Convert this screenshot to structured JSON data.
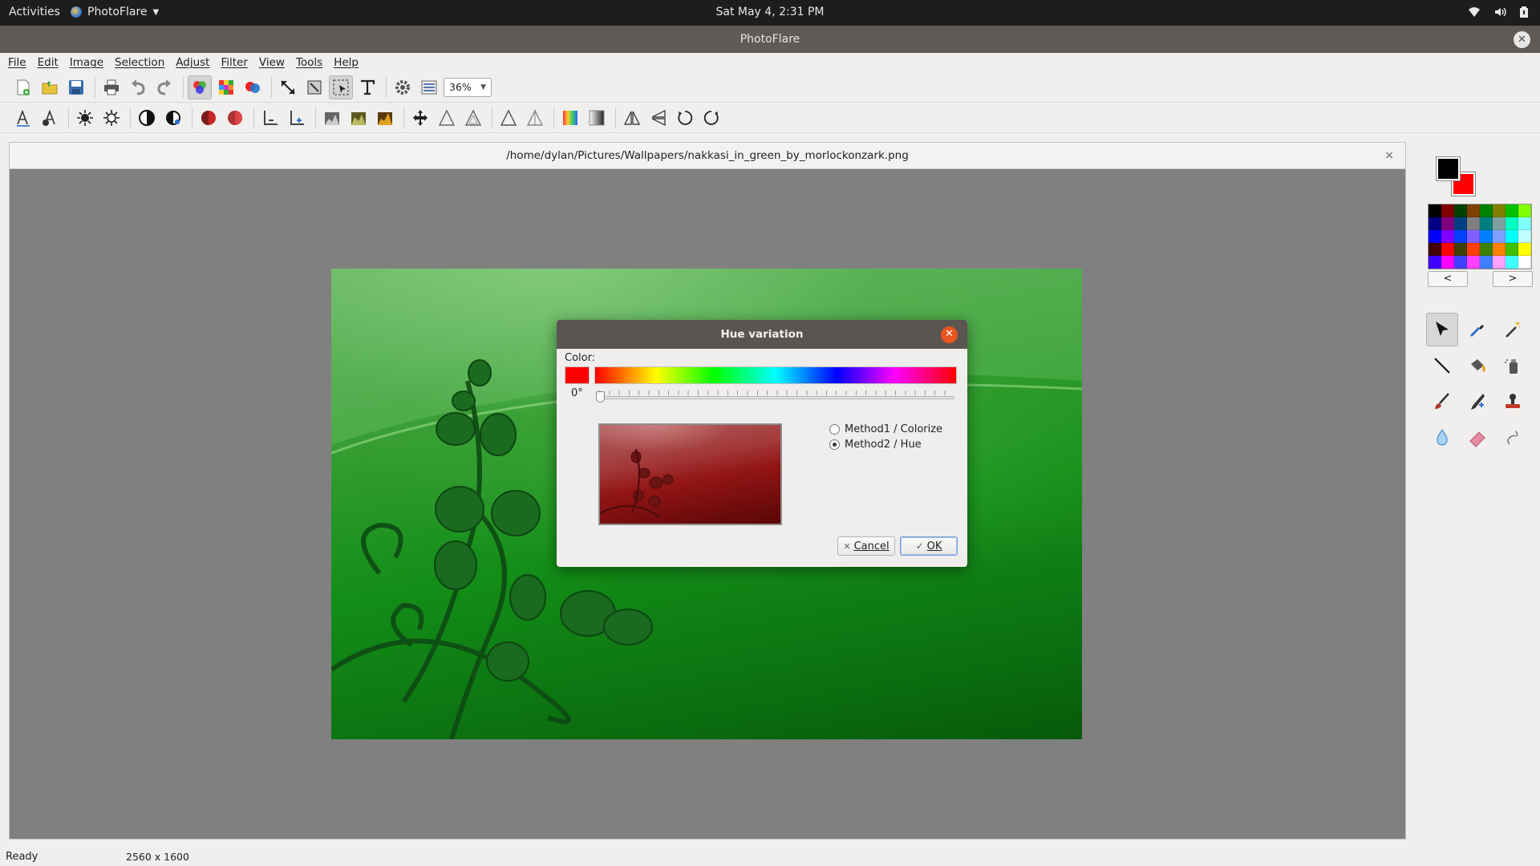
{
  "topbar": {
    "activities": "Activities",
    "app_name": "PhotoFlare",
    "clock": "Sat May  4,  2:31 PM",
    "icons": [
      "wifi-icon",
      "volume-icon",
      "battery-icon"
    ]
  },
  "window": {
    "title": "PhotoFlare"
  },
  "menu": {
    "file": "File",
    "edit": "Edit",
    "image": "Image",
    "selection": "Selection",
    "adjust": "Adjust",
    "filter": "Filter",
    "view": "View",
    "tools": "Tools",
    "help": "Help"
  },
  "toolbar": {
    "zoom": "36%"
  },
  "document": {
    "path": "/home/dylan/Pictures/Wallpapers/nakkasi_in_green_by_morlockonzark.png",
    "close": "×"
  },
  "palette": {
    "prev": "<",
    "next": ">",
    "colors": [
      "#000000",
      "#800000",
      "#004000",
      "#804000",
      "#008000",
      "#808000",
      "#00c000",
      "#80ff00",
      "#000080",
      "#800080",
      "#004080",
      "#808080",
      "#008080",
      "#80a0a0",
      "#00ffc0",
      "#80ffff",
      "#0000ff",
      "#8000ff",
      "#0040ff",
      "#8060ff",
      "#0080ff",
      "#80a0ff",
      "#00ffff",
      "#c0ffff",
      "#400000",
      "#ff0000",
      "#404000",
      "#ff4000",
      "#408000",
      "#ff8000",
      "#40c000",
      "#ffff00",
      "#4000ff",
      "#ff00ff",
      "#4040ff",
      "#ff40ff",
      "#4080ff",
      "#ffa0ff",
      "#40ffff",
      "#ffffff"
    ],
    "foreground": "#000000",
    "background": "#ff0000"
  },
  "status": {
    "ready": "Ready",
    "size": "2560 x 1600"
  },
  "dialog": {
    "title": "Hue variation",
    "color_label": "Color:",
    "selected_color": "#ff0000",
    "angle": "0°",
    "angle_value": 0,
    "method1": "Method1 / Colorize",
    "method2": "Method2 / Hue",
    "selected_method": "method2",
    "cancel": "Cancel",
    "ok": "OK"
  }
}
